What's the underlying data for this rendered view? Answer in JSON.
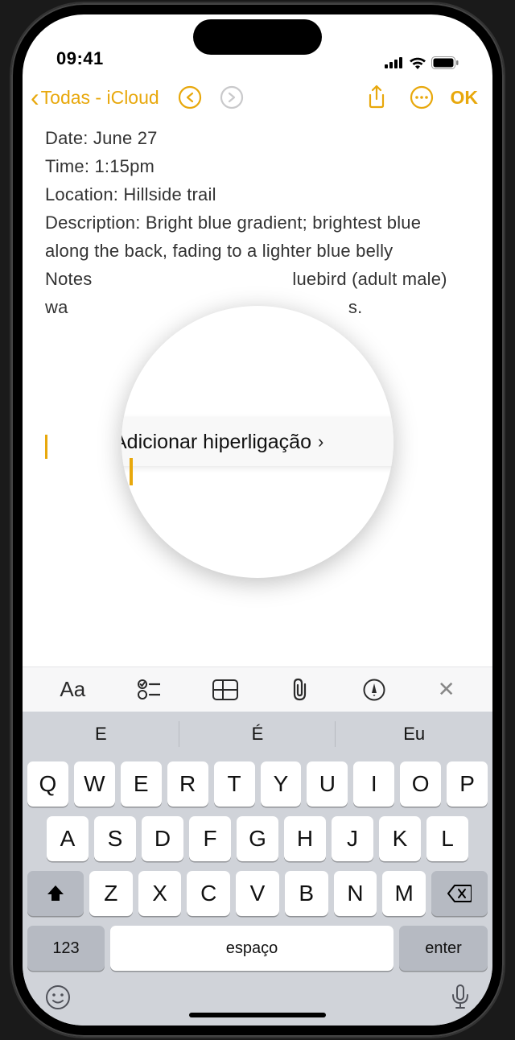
{
  "status": {
    "time": "09:41"
  },
  "toolbar": {
    "back_label": "Todas - iCloud",
    "ok_label": "OK"
  },
  "note": {
    "line1": "Date: June 27",
    "line2": "Time: 1:15pm",
    "line3": "Location: Hillside trail",
    "line4": "Description: Bright blue gradient; brightest blue along the back, fading to a lighter blue belly",
    "line5a": "Notes",
    "line5b": "luebird (adult male)",
    "line6a": "wa",
    "line6b": "s."
  },
  "popup": {
    "label": "Adicionar hiperligação"
  },
  "suggestions": {
    "s1": "E",
    "s2": "É",
    "s3": "Eu"
  },
  "keys": {
    "r1": [
      "Q",
      "W",
      "E",
      "R",
      "T",
      "Y",
      "U",
      "I",
      "O",
      "P"
    ],
    "r2": [
      "A",
      "S",
      "D",
      "F",
      "G",
      "H",
      "J",
      "K",
      "L"
    ],
    "r3": [
      "Z",
      "X",
      "C",
      "V",
      "B",
      "N",
      "M"
    ],
    "num": "123",
    "space": "espaço",
    "enter": "enter"
  }
}
